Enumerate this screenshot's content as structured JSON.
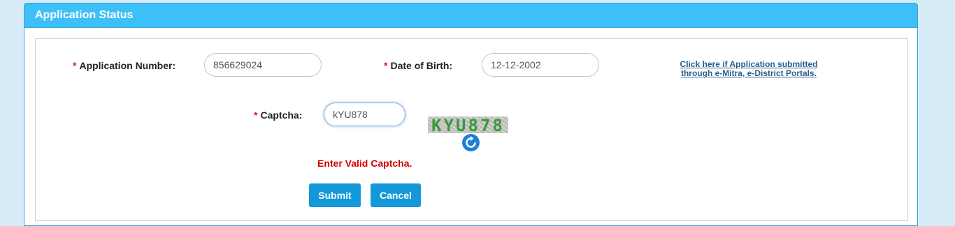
{
  "panel": {
    "title": "Application Status"
  },
  "form": {
    "application_number": {
      "required_mark": "*",
      "label": "Application Number:",
      "value": "856629024"
    },
    "date_of_birth": {
      "required_mark": "*",
      "label": "Date of Birth:",
      "value": "12-12-2002"
    },
    "captcha": {
      "required_mark": "*",
      "label": "Captcha:",
      "value": "kYU878",
      "image_text": "KYU878"
    },
    "external_link": {
      "line1": "Click here if Application submitted",
      "line2": "through e-Mitra, e-District Portals."
    },
    "error_message": "Enter Valid Captcha.",
    "submit_label": "Submit",
    "cancel_label": "Cancel"
  },
  "colors": {
    "header": "#3dbff8",
    "button": "#1399d9",
    "error": "#d40000",
    "required": "#d31a1a",
    "link": "#2b5e8e"
  }
}
